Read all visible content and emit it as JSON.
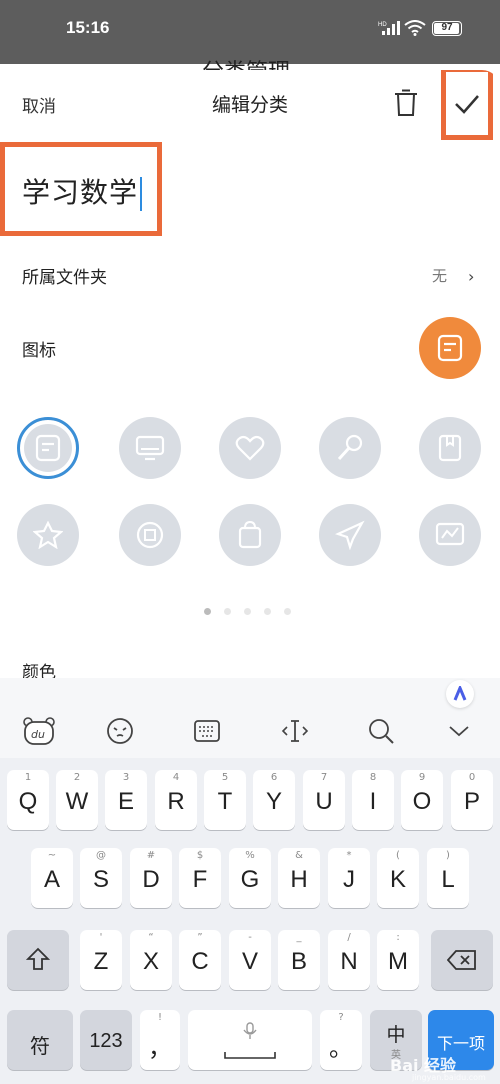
{
  "status_bar": {
    "time": "15:16",
    "network": "HD",
    "battery": "97",
    "background_title": "分类管理"
  },
  "header": {
    "cancel_label": "取消",
    "title": "编辑分类",
    "delete_icon": "trash-icon",
    "confirm_icon": "check-icon"
  },
  "category_name": {
    "value": "学习数学"
  },
  "folder": {
    "label": "所属文件夹",
    "value": "无"
  },
  "icon_section": {
    "label": "图标",
    "selected_icon": "note-icon"
  },
  "icon_grid": [
    "note-icon",
    "monitor-icon",
    "heart-icon",
    "microphone-icon",
    "bookmark-book-icon",
    "star-icon",
    "coin-icon",
    "shopping-bag-icon",
    "airplane-icon",
    "chart-icon"
  ],
  "pager": {
    "pages": 5,
    "current": 1
  },
  "color_section": {
    "label": "颜色"
  },
  "colors": {
    "accent": "#f08a3c",
    "highlight": "#ea6a3a",
    "selection": "#3b8fd6",
    "key_blue": "#2d88ea"
  },
  "keyboard": {
    "toolbar": [
      "du-bear-icon",
      "emoji-icon",
      "keyboard-icon",
      "cursor-icon",
      "search-icon",
      "collapse-chevron-icon"
    ],
    "row1": [
      {
        "k": "Q",
        "s": "1"
      },
      {
        "k": "W",
        "s": "2"
      },
      {
        "k": "E",
        "s": "3"
      },
      {
        "k": "R",
        "s": "4"
      },
      {
        "k": "T",
        "s": "5"
      },
      {
        "k": "Y",
        "s": "6"
      },
      {
        "k": "U",
        "s": "7"
      },
      {
        "k": "I",
        "s": "8"
      },
      {
        "k": "O",
        "s": "9"
      },
      {
        "k": "P",
        "s": "0"
      }
    ],
    "row2": [
      {
        "k": "A",
        "s": "~"
      },
      {
        "k": "S",
        "s": "@"
      },
      {
        "k": "D",
        "s": "#"
      },
      {
        "k": "F",
        "s": "$"
      },
      {
        "k": "G",
        "s": "%"
      },
      {
        "k": "H",
        "s": "&"
      },
      {
        "k": "J",
        "s": "*"
      },
      {
        "k": "K",
        "s": "("
      },
      {
        "k": "L",
        "s": ")"
      }
    ],
    "row3": [
      {
        "k": "Z",
        "s": "'"
      },
      {
        "k": "X",
        "s": "“"
      },
      {
        "k": "C",
        "s": "”"
      },
      {
        "k": "V",
        "s": "-"
      },
      {
        "k": "B",
        "s": "_"
      },
      {
        "k": "N",
        "s": "/"
      },
      {
        "k": "M",
        "s": ":"
      }
    ],
    "symbols_label": "符",
    "numbers_label": "123",
    "comma_key": {
      "k": "，",
      "s": "!"
    },
    "period_key": {
      "k": "。",
      "s": "?"
    },
    "cn_key": {
      "k": "中",
      "s": "英"
    },
    "next_label": "下一项",
    "watermark": "Bai 经验",
    "watermark_url": "jingyan.baidu.com"
  }
}
